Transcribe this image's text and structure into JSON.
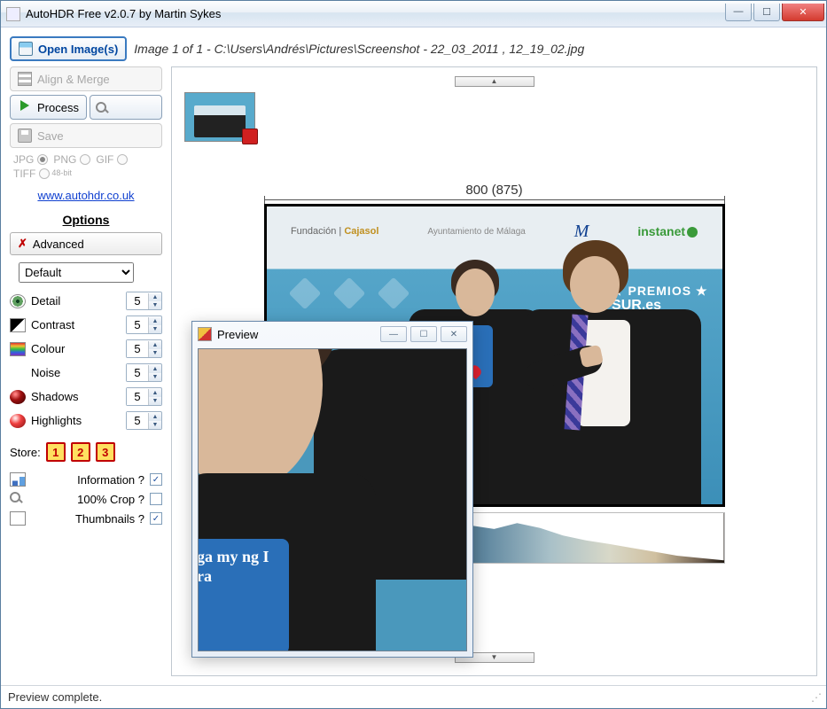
{
  "window": {
    "title": "AutoHDR Free v2.0.7 by Martin Sykes"
  },
  "toolbar": {
    "open_label": "Open Image(s)",
    "align_label": "Align & Merge",
    "process_label": "Process",
    "save_label": "Save"
  },
  "formats": {
    "jpg": "JPG",
    "png": "PNG",
    "gif": "GIF",
    "tiff": "TIFF",
    "tiff_sub": "48-bit"
  },
  "link": "www.autohdr.co.uk",
  "options": {
    "heading": "Options",
    "advanced": "Advanced",
    "preset": "Default"
  },
  "sliders": {
    "detail": {
      "label": "Detail",
      "value": "5"
    },
    "contrast": {
      "label": "Contrast",
      "value": "5"
    },
    "colour": {
      "label": "Colour",
      "value": "5"
    },
    "noise": {
      "label": "Noise",
      "value": "5"
    },
    "shadows": {
      "label": "Shadows",
      "value": "5"
    },
    "highlights": {
      "label": "Highlights",
      "value": "5"
    }
  },
  "store": {
    "label": "Store:",
    "slots": [
      "1",
      "2",
      "3"
    ]
  },
  "checks": {
    "information": "Information ?",
    "crop": "100% Crop ?",
    "thumbnails": "Thumbnails ?"
  },
  "image_status": "Image 1 of 1 - C:\\Users\\Andrés\\Pictures\\Screenshot - 22_03_2011 , 12_19_02.jpg",
  "dimension": "800 (875)",
  "overlay_logos": {
    "l1a": "Fundación",
    "l1b": "Cajasol",
    "l2": "Ayuntamiento de Málaga",
    "l4": "instanet"
  },
  "overlay_premios": {
    "top": "★ PREMIOS ★",
    "mid": "SUR.es"
  },
  "preview": {
    "title": "Preview",
    "tee_text": "ga\nmy\nng I\nra "
  },
  "status": "Preview complete."
}
